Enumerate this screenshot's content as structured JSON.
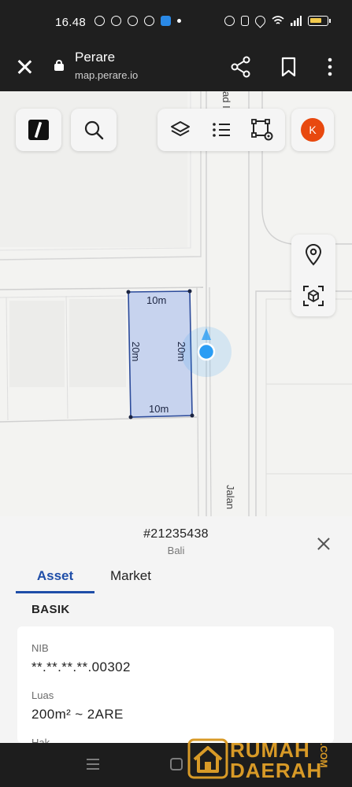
{
  "status_bar": {
    "time": "16.48",
    "left_icons": [
      "notification-icon",
      "messenger-icon",
      "messenger-icon",
      "facebook-icon",
      "telegram-icon",
      "dot-icon"
    ],
    "right_icons": [
      "alarm-icon",
      "vibrate-icon",
      "location-icon",
      "wifi-icon",
      "signal-icon",
      "battery-icon"
    ]
  },
  "browser": {
    "title": "Perare",
    "url": "map.perare.io"
  },
  "map": {
    "parcel": {
      "top_dim": "10m",
      "bottom_dim": "10m",
      "left_dim": "20m",
      "right_dim": "20m",
      "fill_color": "#c7d3ee",
      "stroke_color": "#2b4a9a"
    },
    "street_labels": [
      "Jalan",
      "ad I"
    ],
    "location_dot_color": "#2a9df4",
    "avatar_initial": "K",
    "avatar_color": "#e8490f"
  },
  "sheet": {
    "parcel_id": "#21235438",
    "subtitle": "Bali",
    "tabs": {
      "asset": "Asset",
      "market": "Market"
    },
    "active_tab": "Asset",
    "section_title": "BASIK",
    "fields": [
      {
        "label": "NIB",
        "value": "**.**.**.**.00302"
      },
      {
        "label": "Luas",
        "value": "200m² ~ 2ARE"
      },
      {
        "label": "Hak",
        "value": ""
      }
    ]
  },
  "watermark": {
    "line1": "RUMAH",
    "line2": "DAERAH",
    "suffix": ".COM"
  }
}
